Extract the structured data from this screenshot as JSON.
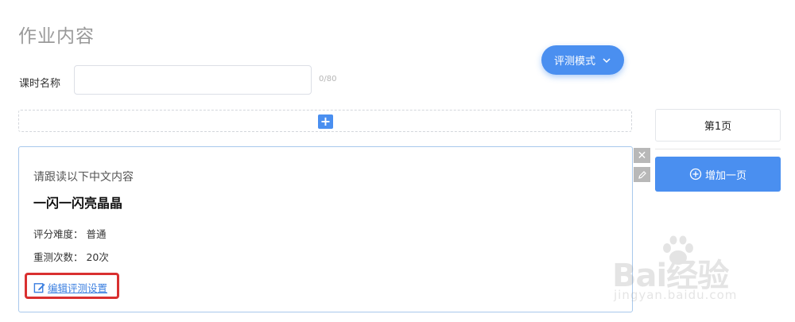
{
  "page": {
    "title": "作业内容"
  },
  "mode": {
    "label": "评测模式",
    "accent": "#4a8ff0"
  },
  "lesson": {
    "label": "课时名称",
    "value": "",
    "placeholder": "",
    "count": "0/80"
  },
  "card": {
    "instruction": "请跟读以下中文内容",
    "content": "一闪一闪亮晶晶",
    "difficulty": "评分难度： 普通",
    "retest": "重测次数： 20次",
    "edit_link": "编辑评测设置",
    "highlight_color": "#d93030"
  },
  "side_actions": {
    "close_glyph": "✕",
    "close_icon": "close-icon",
    "edit_icon": "pencil-icon"
  },
  "pages": {
    "current_tab": "第1页",
    "add_label": "增加一页"
  },
  "add_block": {
    "glyph": "+"
  },
  "watermark": {
    "main": "Bai经验",
    "sub": "jingyan.baidu.com"
  }
}
